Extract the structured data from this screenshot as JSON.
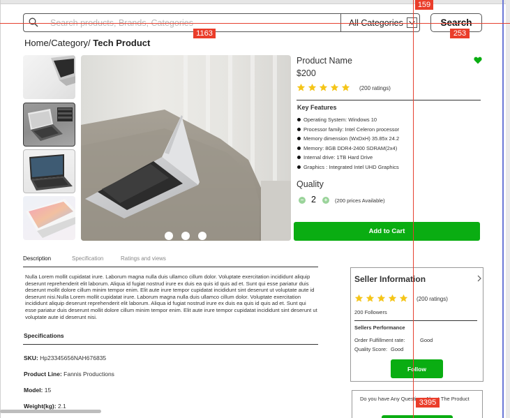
{
  "search": {
    "placeholder": "Search products, Brands, Categories",
    "category_label": "All Categories",
    "button_label": "Search"
  },
  "breadcrumb": {
    "path": "Home/Category/ ",
    "current": "Tech Product"
  },
  "product": {
    "name": "Product Name",
    "price": "$200",
    "rating_count": "(200 ratings)",
    "rating_stars": 5,
    "key_features_title": "Key Features",
    "features": [
      "Operating System: Windows 10",
      "Processor family:  Intel Celeron processor",
      "Memory dimension (WxDxH) 35.85x 24.2",
      "Memory: 8GB DDR4-2400 SDRAM(2x4)",
      "Internal drive: 1TB Hard Drive",
      "Graphics : Integrated  Intel UHD Graphics"
    ],
    "quality_label": "Quality",
    "quantity": "2",
    "available": "(200 prices Available)",
    "add_to_cart_label": "Add to  Cart",
    "image_count": 3,
    "colors": {
      "accent": "#0aad12",
      "star": "#f5c518"
    }
  },
  "tabs": [
    "Description",
    "Specification",
    "Ratings and views"
  ],
  "description": "Nulla Lorem mollit cupidatat irure. Laborum magna nulla duis ullamco cillum dolor. Voluptate exercitation incididunt aliquip deserunt reprehenderit elit laborum. Aliqua id fugiat nostrud irure ex duis ea quis id quis ad et. Sunt qui esse pariatur duis deserunt mollit dolore cillum minim tempor enim. Elit aute irure tempor cupidatat incididunt sint deserunt ut voluptate aute id deserunt nisi.Nulla Lorem mollit cupidatat irure. Laborum magna nulla duis ullamco cillum dolor. Voluptate exercitation incididunt aliquip deserunt reprehenderit elit laborum. Aliqua id fugiat nostrud irure ex duis ea quis id quis ad et. Sunt qui esse pariatur duis deserunt mollit dolore cillum minim tempor enim. Elit aute irure tempor cupidatat incididunt sint deserunt ut voluptate aute id deserunt nisi.",
  "specifications": {
    "title": "Specifications",
    "rows": [
      {
        "label": "SKU:",
        "value": "Hp23345656NAH676835"
      },
      {
        "label": "Product Line:",
        "value": "Fannis Productions"
      },
      {
        "label": "Model:",
        "value": "15"
      },
      {
        "label": "Weight(kg):",
        "value": "2.1"
      }
    ]
  },
  "seller": {
    "title": "Seller Information",
    "rating_count": "(200 ratings)",
    "rating_stars": 5,
    "followers": "200 Followers",
    "performance_title": "Sellers Performance",
    "rows": [
      {
        "label": "Order Fulfillment rate:",
        "value": "Good"
      },
      {
        "label": "Quality Score:",
        "value": "Good"
      }
    ],
    "follow_label": "Follow"
  },
  "question": {
    "text": "Do you have Any Questions About The Product"
  },
  "overlay_tags": [
    "159",
    "1163",
    "253",
    "3395"
  ]
}
